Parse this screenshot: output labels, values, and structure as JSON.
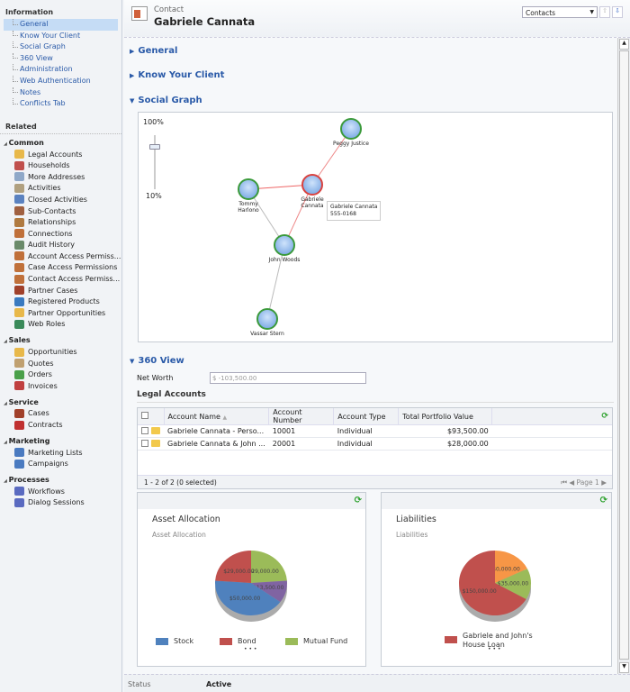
{
  "sidebar": {
    "information_label": "Information",
    "info_links": [
      "General",
      "Know Your Client",
      "Social Graph",
      "360 View",
      "Administration",
      "Web Authentication",
      "Notes",
      "Conflicts Tab"
    ],
    "related_label": "Related",
    "groups": [
      {
        "label": "Common",
        "items": [
          {
            "label": "Legal Accounts",
            "icon": "folder-icon",
            "color": "#e8b84a"
          },
          {
            "label": "Households",
            "icon": "household-icon",
            "color": "#c0504d"
          },
          {
            "label": "More Addresses",
            "icon": "address-icon",
            "color": "#8fa8c8"
          },
          {
            "label": "Activities",
            "icon": "activities-icon",
            "color": "#b0a080"
          },
          {
            "label": "Closed Activities",
            "icon": "closed-activities-icon",
            "color": "#5b82c0"
          },
          {
            "label": "Sub-Contacts",
            "icon": "contact-icon",
            "color": "#a06040"
          },
          {
            "label": "Relationships",
            "icon": "relationships-icon",
            "color": "#b07a40"
          },
          {
            "label": "Connections",
            "icon": "connections-icon",
            "color": "#c0703a"
          },
          {
            "label": "Audit History",
            "icon": "audit-icon",
            "color": "#6a8a6a"
          },
          {
            "label": "Account Access Permiss...",
            "icon": "permissions-icon",
            "color": "#c0703a"
          },
          {
            "label": "Case Access Permissions",
            "icon": "permissions-icon",
            "color": "#c0703a"
          },
          {
            "label": "Contact Access Permiss...",
            "icon": "permissions-icon",
            "color": "#c0703a"
          },
          {
            "label": "Partner Cases",
            "icon": "cases-icon",
            "color": "#a0402a"
          },
          {
            "label": "Registered Products",
            "icon": "products-icon",
            "color": "#3a7ac0"
          },
          {
            "label": "Partner Opportunities",
            "icon": "opportunities-icon",
            "color": "#e8b84a"
          },
          {
            "label": "Web Roles",
            "icon": "globe-icon",
            "color": "#3a8a5a"
          }
        ]
      },
      {
        "label": "Sales",
        "items": [
          {
            "label": "Opportunities",
            "icon": "opportunities-icon",
            "color": "#e8b84a"
          },
          {
            "label": "Quotes",
            "icon": "quotes-icon",
            "color": "#c0a070"
          },
          {
            "label": "Orders",
            "icon": "orders-icon",
            "color": "#4aa04a"
          },
          {
            "label": "Invoices",
            "icon": "invoices-icon",
            "color": "#c04040"
          }
        ]
      },
      {
        "label": "Service",
        "items": [
          {
            "label": "Cases",
            "icon": "cases-icon",
            "color": "#a0402a"
          },
          {
            "label": "Contracts",
            "icon": "contracts-icon",
            "color": "#c03030"
          }
        ]
      },
      {
        "label": "Marketing",
        "items": [
          {
            "label": "Marketing Lists",
            "icon": "marketing-list-icon",
            "color": "#4a7ac0"
          },
          {
            "label": "Campaigns",
            "icon": "campaign-icon",
            "color": "#4a7ac0"
          }
        ]
      },
      {
        "label": "Processes",
        "items": [
          {
            "label": "Workflows",
            "icon": "workflow-icon",
            "color": "#5a6ac0"
          },
          {
            "label": "Dialog Sessions",
            "icon": "dialog-icon",
            "color": "#5a6ac0"
          }
        ]
      }
    ]
  },
  "header": {
    "entity": "Contact",
    "name": "Gabriele Cannata",
    "selector": "Contacts"
  },
  "sections": {
    "general": "General",
    "kyc": "Know Your Client",
    "social": "Social Graph",
    "view360": "360 View"
  },
  "social_graph": {
    "zoom_max": "100%",
    "zoom_min": "10%",
    "zoom_level": 0.9,
    "nodes": [
      "Peggy Justice",
      "Gabriele Cannata",
      "Tommy Harlono",
      "John Woods",
      "Vassar Stern"
    ],
    "node_labels": {
      "peggy": "Peggy Justice",
      "gabriele": "Gabriele\nCannata",
      "tommy": "Tommy\nHarlono",
      "john": "John Woods",
      "vassar": "Vassar Stern"
    },
    "tooltip": {
      "name": "Gabriele Cannata",
      "phone": "555-0168"
    }
  },
  "view360": {
    "net_worth_label": "Net Worth",
    "net_worth_value": "$ -103,500.00",
    "legal_accounts_label": "Legal Accounts",
    "columns": [
      "Account Name",
      "Account Number",
      "Account Type",
      "Total Portfolio Value"
    ],
    "rows": [
      [
        "Gabriele Cannata - Perso...",
        "10001",
        "Individual",
        "$93,500.00"
      ],
      [
        "Gabriele Cannata & John ...",
        "20001",
        "Individual",
        "$28,000.00"
      ]
    ],
    "footer": "1 - 2 of 2 (0 selected)",
    "page": "Page 1"
  },
  "chart_data": [
    {
      "type": "pie",
      "title": "Asset Allocation",
      "subtitle": "Asset Allocation",
      "slices": [
        {
          "name": "Mutual Fund",
          "value": 29000,
          "label": "$29,000.00",
          "color": "#9bbb59"
        },
        {
          "name": "",
          "value": 13500,
          "label": "$13,500.00",
          "color": "#8064a2"
        },
        {
          "name": "Stock",
          "value": 50000,
          "label": "$50,000.00",
          "color": "#4f81bd"
        },
        {
          "name": "Bond",
          "value": 29000,
          "label": "$29,000.00",
          "color": "#c0504d"
        }
      ],
      "legend": [
        "Stock",
        "Bond",
        "Mutual Fund"
      ],
      "legend_more": "• • •"
    },
    {
      "type": "pie",
      "title": "Liabilities",
      "subtitle": "Liabilities",
      "slices": [
        {
          "name": "",
          "value": 40000,
          "label": "$40,000.00",
          "color": "#f79646"
        },
        {
          "name": "",
          "value": 35000,
          "label": "$35,000.00",
          "color": "#9bbb59"
        },
        {
          "name": "Gabriele and John's House Loan",
          "value": 150000,
          "label": "$150,000.00",
          "color": "#c0504d"
        }
      ],
      "legend": [
        "Gabriele and John's House Loan"
      ],
      "legend_more": "• • •"
    }
  ],
  "status": {
    "label": "Status",
    "value": "Active"
  }
}
